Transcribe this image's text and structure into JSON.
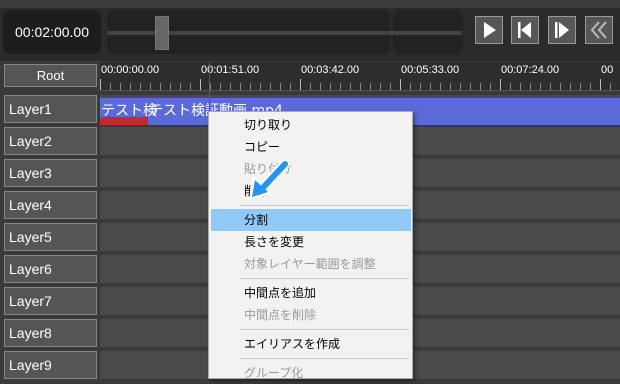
{
  "player": {
    "timecode": "00:02:00.00",
    "controls": [
      "play",
      "prev-frame",
      "next-frame",
      "rewind"
    ]
  },
  "timeline": {
    "root_label": "Root",
    "ticks": [
      "00:00:00.00",
      "00:01:51.00",
      "00:03:42.00",
      "00:05:33.00",
      "00:07:24.00",
      "00"
    ],
    "layers": [
      "Layer1",
      "Layer2",
      "Layer3",
      "Layer4",
      "Layer5",
      "Layer6",
      "Layer7",
      "Layer8",
      "Layer9"
    ],
    "clip_text_a": "テスト検",
    "clip_text_b": "テスト検証動画.mp4"
  },
  "context_menu": {
    "items": [
      {
        "label": "切り取り",
        "disabled": false
      },
      {
        "label": "コピー",
        "disabled": false
      },
      {
        "label": "貼り付け",
        "disabled": true
      },
      {
        "label": "削除",
        "disabled": false
      },
      {
        "label": "分割",
        "disabled": false,
        "highlighted": true
      },
      {
        "label": "長さを変更",
        "disabled": false
      },
      {
        "label": "対象レイヤー範囲を調整",
        "disabled": true
      },
      {
        "label": "中間点を追加",
        "disabled": false
      },
      {
        "label": "中間点を削除",
        "disabled": true
      },
      {
        "label": "エイリアスを作成",
        "disabled": false
      },
      {
        "label": "グループ化",
        "disabled": true
      }
    ]
  },
  "colors": {
    "clip": "#5a6ad8",
    "clip_marker": "#c12b2b",
    "playhead": "#dd2222",
    "menu_highlight": "#90c8f6",
    "annotation_arrow": "#2196f3"
  }
}
